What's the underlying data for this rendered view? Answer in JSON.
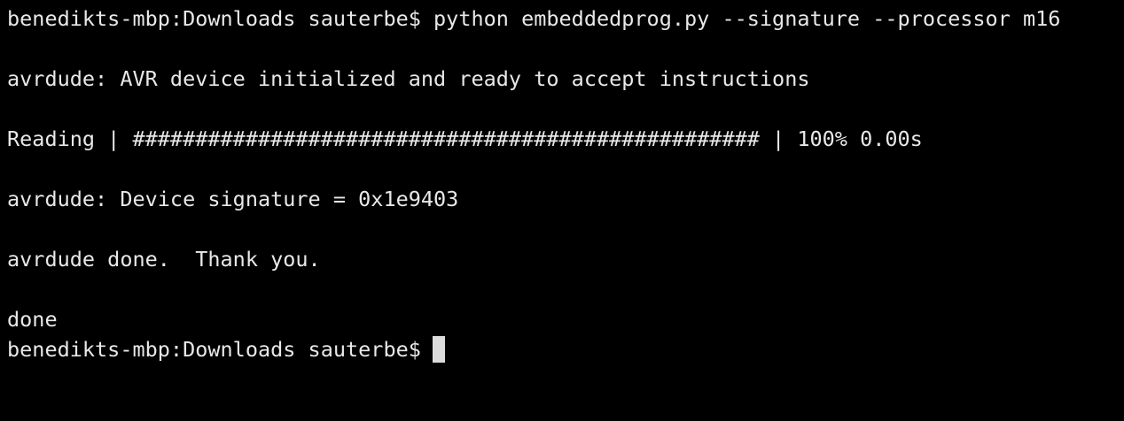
{
  "terminal": {
    "lines": [
      "benedikts-mbp:Downloads sauterbe$ python embeddedprog.py --signature --processor m16",
      "",
      "avrdude: AVR device initialized and ready to accept instructions",
      "",
      "Reading | ################################################## | 100% 0.00s",
      "",
      "avrdude: Device signature = 0x1e9403",
      "",
      "avrdude done.  Thank you.",
      "",
      "done"
    ],
    "prompt": "benedikts-mbp:Downloads sauterbe$",
    "colors": {
      "background": "#000000",
      "foreground": "#e8e8e8",
      "cursor": "#dcdcdc"
    }
  }
}
